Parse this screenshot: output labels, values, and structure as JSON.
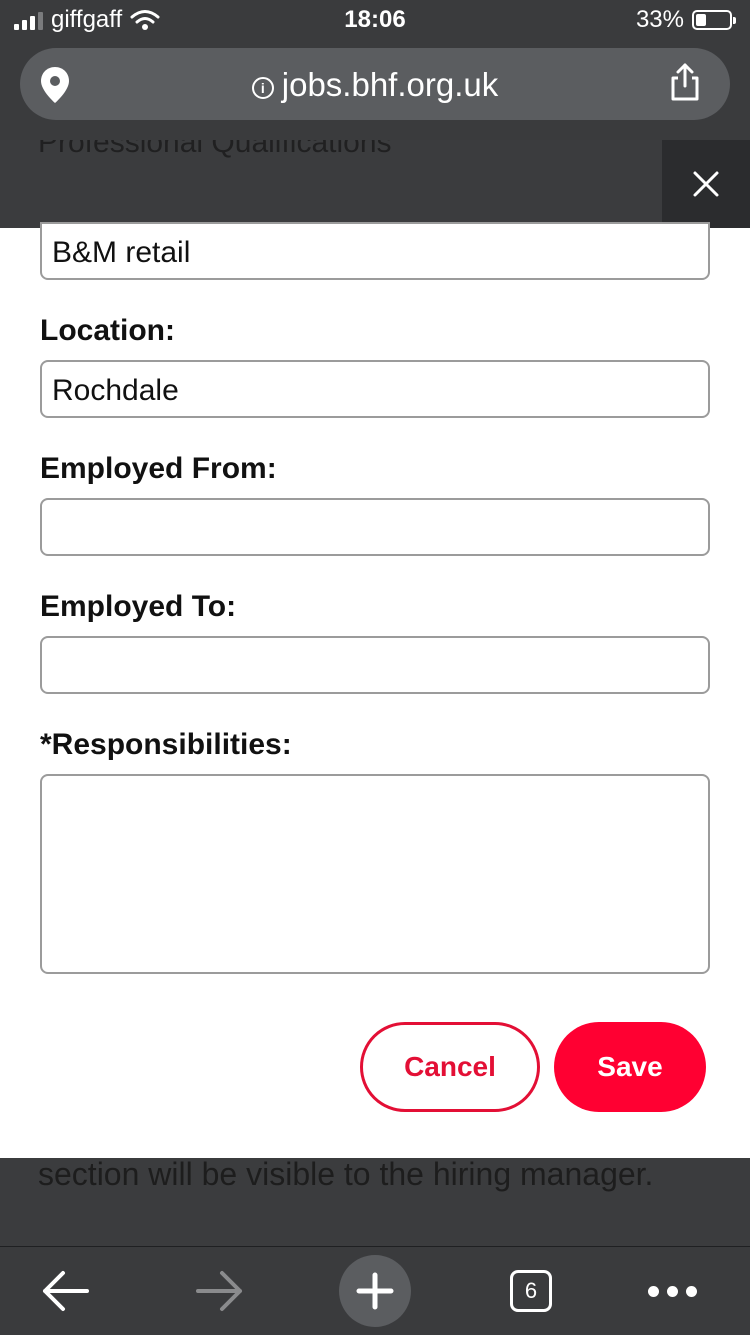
{
  "status_bar": {
    "carrier": "giffgaff",
    "time": "18:06",
    "battery": "33%"
  },
  "browser": {
    "url": "jobs.bhf.org.uk",
    "tabs_count": "6"
  },
  "background": {
    "heading_partial": "Professional Qualifications",
    "text_partial": "section will be visible to the hiring manager."
  },
  "form": {
    "employer_value": "B&M retail",
    "location_label": "Location:",
    "location_value": "Rochdale",
    "employed_from_label": "Employed From:",
    "employed_from_value": "",
    "employed_to_label": "Employed To:",
    "employed_to_value": "",
    "responsibilities_label": "*Responsibilities:",
    "responsibilities_value": "",
    "cancel_label": "Cancel",
    "save_label": "Save"
  },
  "colors": {
    "accent": "#ff0032",
    "cancel_border": "#e30f35",
    "overlay": "#3b3c3e"
  },
  "icons": [
    "signal-icon",
    "wifi-icon",
    "battery-icon",
    "location-pin-icon",
    "info-icon",
    "share-icon",
    "close-icon",
    "back-arrow-icon",
    "forward-arrow-icon",
    "plus-icon",
    "tabs-icon",
    "more-icon"
  ]
}
